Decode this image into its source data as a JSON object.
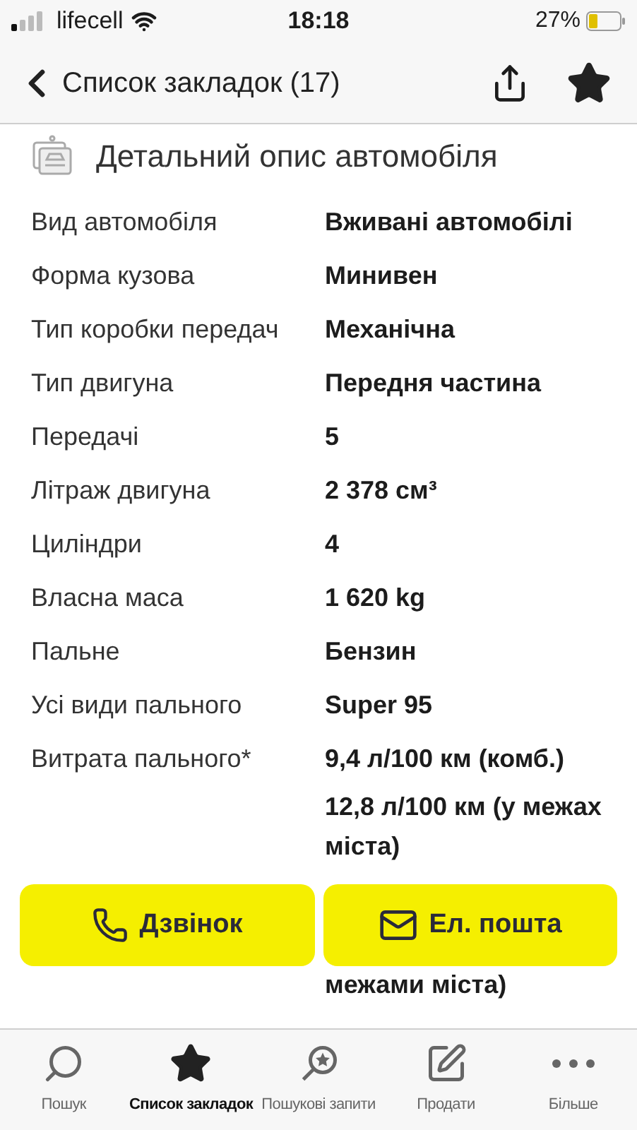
{
  "status_bar": {
    "carrier": "lifecell",
    "time": "18:18",
    "battery": "27%"
  },
  "nav_bar": {
    "back_label": "Список закладок (17)",
    "bookmarked": true
  },
  "section": {
    "title": "Детальний опис автомобіля"
  },
  "rows": [
    {
      "label": "Вид автомобіля",
      "values": [
        "Вживані автомобілі"
      ]
    },
    {
      "label": "Форма кузова",
      "values": [
        "Минивен"
      ]
    },
    {
      "label": "Тип коробки передач",
      "values": [
        "Механічна"
      ]
    },
    {
      "label": "Тип двигуна",
      "values": [
        "Передня частина"
      ]
    },
    {
      "label": "Передачі",
      "values": [
        "5"
      ]
    },
    {
      "label": "Літраж двигуна",
      "values": [
        "2 378 см³"
      ]
    },
    {
      "label": "Циліндри",
      "values": [
        "4"
      ]
    },
    {
      "label": "Власна маса",
      "values": [
        "1 620 kg"
      ]
    },
    {
      "label": "Пальне",
      "values": [
        "Бензин"
      ]
    },
    {
      "label": "Усі види пального",
      "values": [
        "Super 95"
      ]
    },
    {
      "label": "Витрата пального*",
      "values": [
        "9,4 л/100 км (комб.)",
        "12,8 л/100 км (у межах міста)"
      ]
    }
  ],
  "partly_hidden_value": "межами міста)",
  "actions": [
    {
      "kind": "call",
      "label": "Дзвінок"
    },
    {
      "kind": "email",
      "label": "Ел. пошта"
    }
  ],
  "tab_bar": [
    {
      "kind": "search",
      "label": "Пошук",
      "selected": false
    },
    {
      "kind": "bookmarks",
      "label": "Список закладок",
      "selected": true
    },
    {
      "kind": "saved_searches",
      "label": "Пошукові запити",
      "selected": false
    },
    {
      "kind": "sell",
      "label": "Продати",
      "selected": false
    },
    {
      "kind": "more",
      "label": "Більше",
      "selected": false
    }
  ]
}
